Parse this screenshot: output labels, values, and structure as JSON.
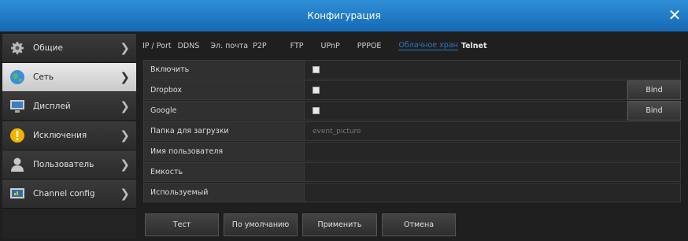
{
  "window": {
    "title": "Конфигурация"
  },
  "sidebar": {
    "items": [
      {
        "label": "Общие",
        "icon": "gear-icon"
      },
      {
        "label": "Сеть",
        "icon": "globe-icon",
        "active": true
      },
      {
        "label": "Дисплей",
        "icon": "monitor-icon"
      },
      {
        "label": "Исключения",
        "icon": "warning-icon"
      },
      {
        "label": "Пользователь",
        "icon": "user-icon"
      },
      {
        "label": "Channel config",
        "icon": "channel-config-icon"
      }
    ]
  },
  "tabs": [
    {
      "label": "IP / Port"
    },
    {
      "label": "DDNS"
    },
    {
      "label": "Эл. почта"
    },
    {
      "label": "P2P"
    },
    {
      "label": "FTP"
    },
    {
      "label": "UPnP"
    },
    {
      "label": "PPPOE"
    },
    {
      "label": "Облачное хран",
      "active": true
    },
    {
      "label": "Telnet"
    }
  ],
  "form": {
    "enable_label": "Включить",
    "dropbox_label": "Dropbox",
    "google_label": "Google",
    "bind_label": "Bind",
    "folder_label": "Папка для загрузки",
    "folder_placeholder": "event_picture",
    "username_label": "Имя пользователя",
    "capacity_label": "Емкость",
    "used_label": "Используемый"
  },
  "buttons": {
    "test": "Тест",
    "default": "По умолчанию",
    "apply": "Применить",
    "cancel": "Отмена"
  },
  "colors": {
    "titlebar": "#1f78c8",
    "active_tab": "#2a78c8"
  }
}
